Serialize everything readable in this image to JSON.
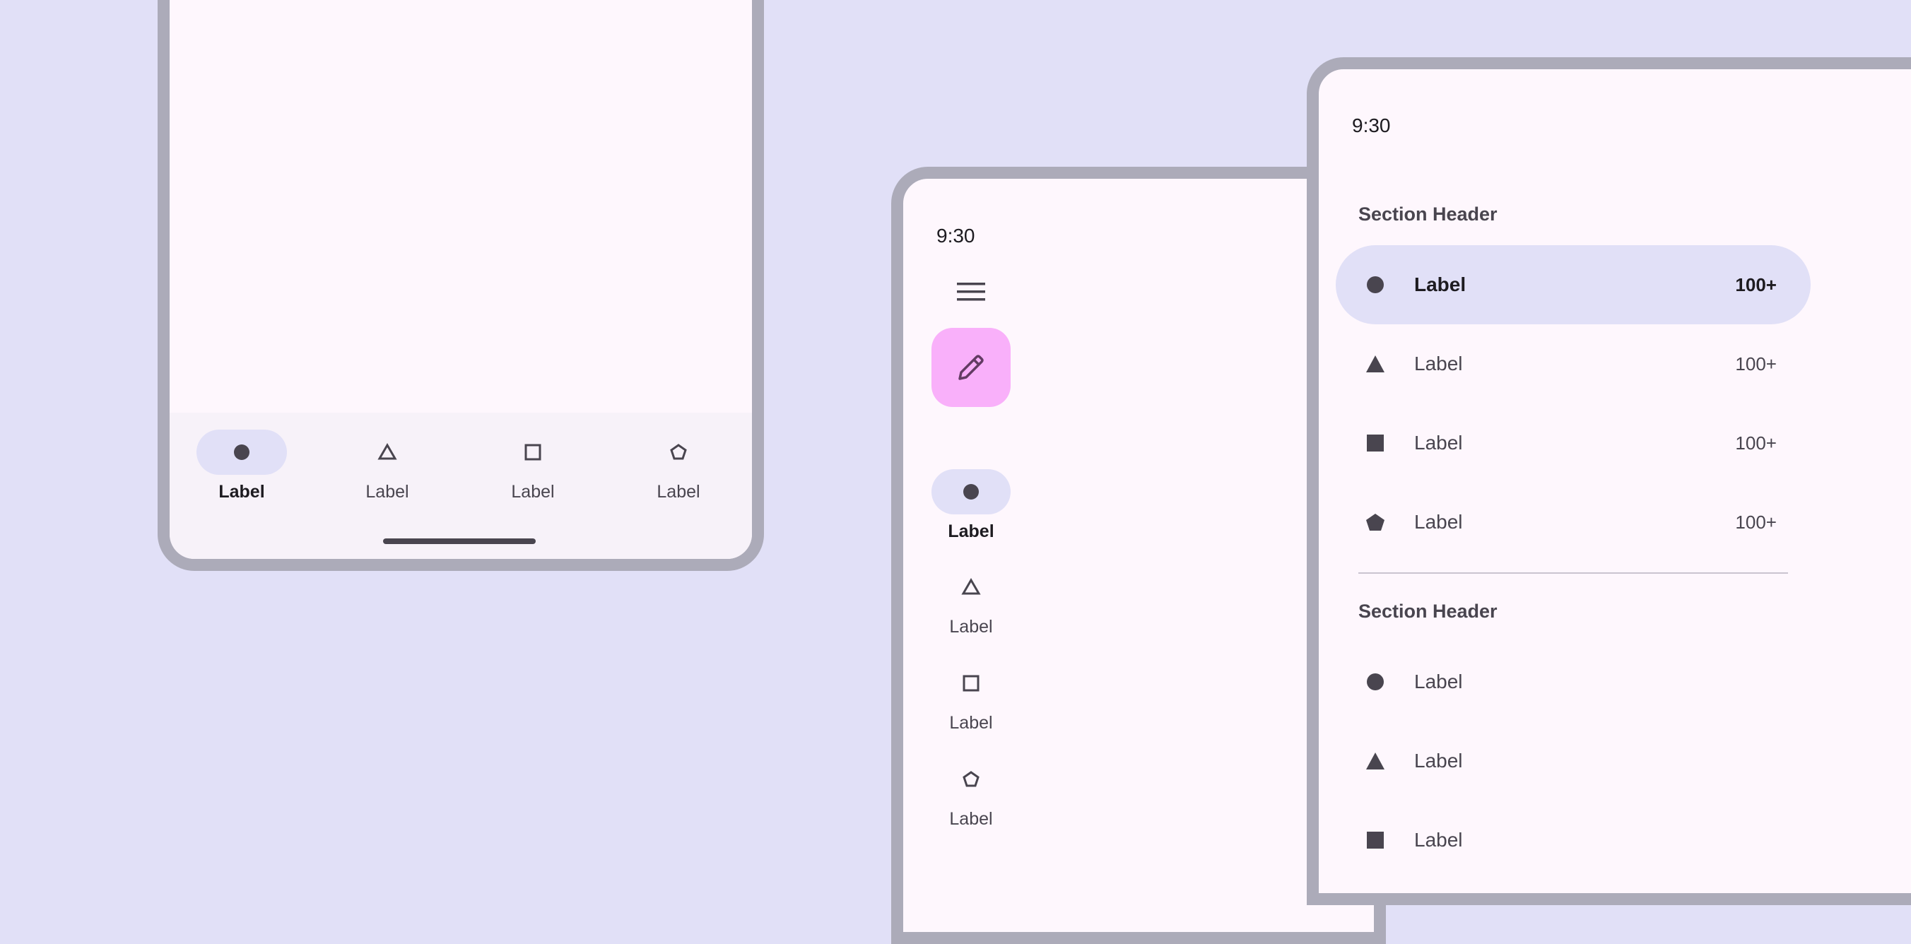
{
  "phone": {
    "nav": [
      {
        "label": "Label",
        "icon": "circle-icon",
        "active": true
      },
      {
        "label": "Label",
        "icon": "triangle-outline-icon",
        "active": false
      },
      {
        "label": "Label",
        "icon": "square-outline-icon",
        "active": false
      },
      {
        "label": "Label",
        "icon": "pentagon-outline-icon",
        "active": false
      }
    ]
  },
  "tablet": {
    "time": "9:30",
    "menu_icon": "menu-icon",
    "fab_icon": "edit-icon",
    "rail": [
      {
        "label": "Label",
        "icon": "circle-icon",
        "active": true
      },
      {
        "label": "Label",
        "icon": "triangle-outline-icon",
        "active": false
      },
      {
        "label": "Label",
        "icon": "square-outline-icon",
        "active": false
      },
      {
        "label": "Label",
        "icon": "pentagon-outline-icon",
        "active": false
      }
    ]
  },
  "drawer": {
    "time": "9:30",
    "sections": [
      {
        "header": "Section Header",
        "items": [
          {
            "label": "Label",
            "badge": "100+",
            "icon": "circle-icon",
            "active": true
          },
          {
            "label": "Label",
            "badge": "100+",
            "icon": "triangle-icon",
            "active": false
          },
          {
            "label": "Label",
            "badge": "100+",
            "icon": "square-icon",
            "active": false
          },
          {
            "label": "Label",
            "badge": "100+",
            "icon": "pentagon-icon",
            "active": false
          }
        ]
      },
      {
        "header": "Section Header",
        "items": [
          {
            "label": "Label",
            "icon": "circle-icon",
            "active": false
          },
          {
            "label": "Label",
            "icon": "triangle-icon",
            "active": false
          },
          {
            "label": "Label",
            "icon": "square-icon",
            "active": false
          }
        ]
      }
    ]
  },
  "colors": {
    "background": "#e1e0f7",
    "surface": "#fef7fd",
    "frame": "#acabb9",
    "active_indicator": "#e1e0f7",
    "fab": "#f9b0fa",
    "icon": "#49454f"
  }
}
